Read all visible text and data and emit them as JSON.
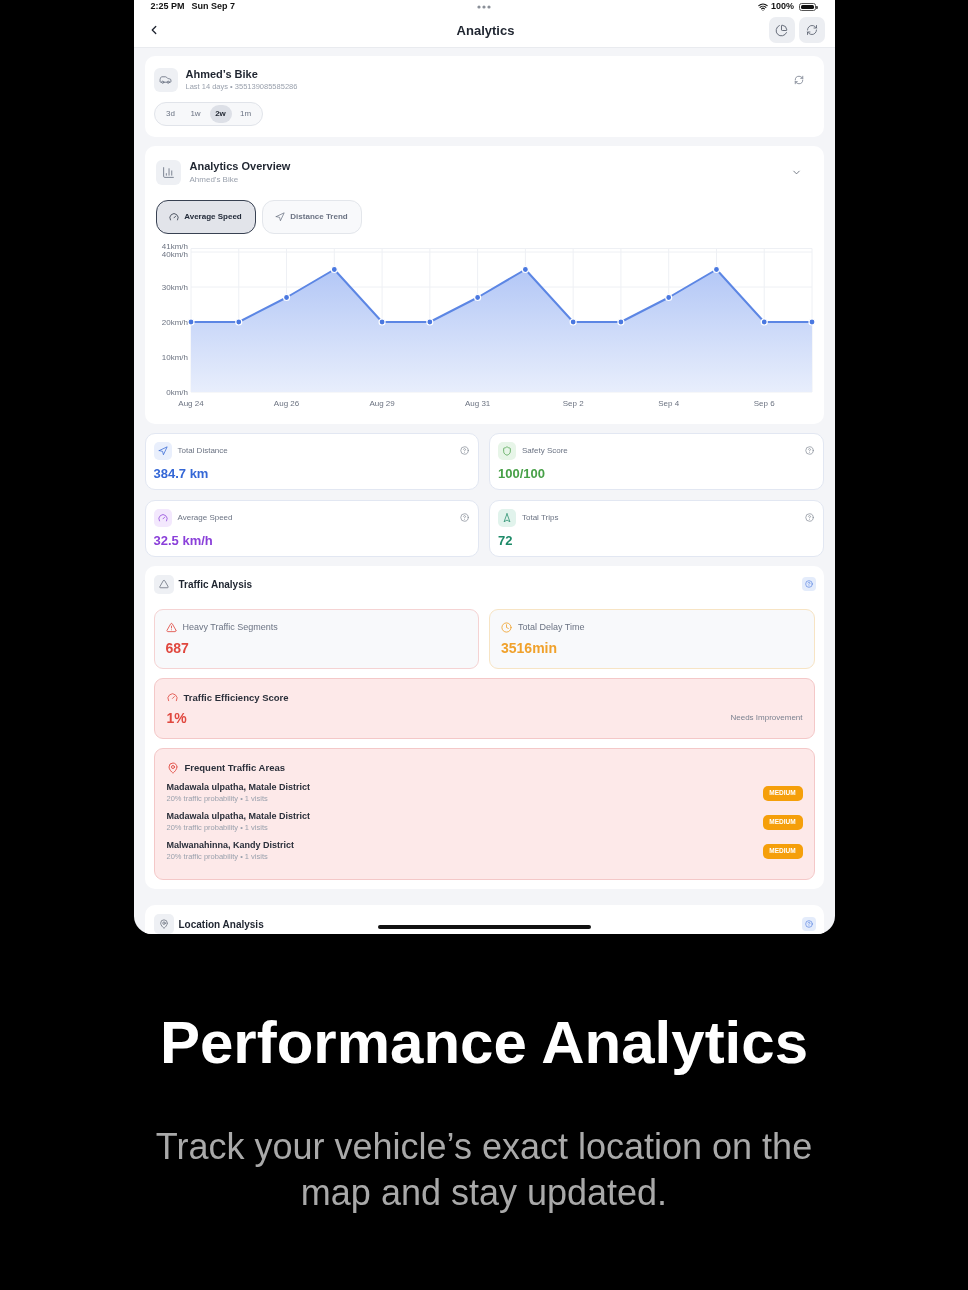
{
  "status_bar": {
    "time": "2:25 PM",
    "date": "Sun Sep 7",
    "battery": "100%"
  },
  "nav": {
    "title": "Analytics"
  },
  "vehicle": {
    "name": "Ahmed’s Bike",
    "subtitle": "Last 14 days • 355139085585286",
    "ranges": [
      {
        "label": "3d",
        "selected": false
      },
      {
        "label": "1w",
        "selected": false
      },
      {
        "label": "2w",
        "selected": true
      },
      {
        "label": "1m",
        "selected": false
      }
    ]
  },
  "overview": {
    "title": "Analytics Overview",
    "subtitle": "Ahmed's Bike",
    "tabs": [
      {
        "kind": "speed",
        "label": "Average Speed",
        "selected": true
      },
      {
        "kind": "distance",
        "label": "Distance Trend",
        "selected": false
      }
    ],
    "chart_data": {
      "type": "area",
      "grid": true,
      "categories": [
        "Aug 24",
        null,
        "Aug 26",
        null,
        "Aug 29",
        null,
        "Aug 31",
        null,
        "Sep 2",
        null,
        "Sep 4",
        null,
        "Sep 6",
        null
      ],
      "values": [
        20,
        20,
        27,
        35,
        20,
        20,
        27,
        35,
        20,
        20,
        27,
        35,
        20,
        20
      ],
      "ylim": [
        0,
        41
      ],
      "yticks": [
        {
          "value": 0,
          "label": "0km/h"
        },
        {
          "value": 10,
          "label": "10km/h"
        },
        {
          "value": 20,
          "label": "20km/h"
        },
        {
          "value": 30,
          "label": "30km/h"
        },
        {
          "value": 40,
          "label": "40km/h"
        },
        {
          "value": 41,
          "label": "41km/h"
        }
      ]
    }
  },
  "stats": [
    {
      "kind": "distance",
      "label": "Total Distance",
      "value": "384.7 km",
      "color": "#3467d6"
    },
    {
      "kind": "safety",
      "label": "Safety Score",
      "value": "100/100",
      "color": "#47a047"
    },
    {
      "kind": "speed",
      "label": "Average Speed",
      "value": "32.5 km/h",
      "color": "#8a3fd9"
    },
    {
      "kind": "trips",
      "label": "Total Trips",
      "value": "72",
      "color": "#1d8a68"
    }
  ],
  "traffic": {
    "title": "Traffic Analysis",
    "metrics": [
      {
        "kind": "heavy",
        "label": "Heavy Traffic Segments",
        "value": "687",
        "color": "#e0483f"
      },
      {
        "kind": "delay",
        "label": "Total Delay Time",
        "value": "3516min",
        "color": "#f0a12b"
      }
    ],
    "efficiency": {
      "title": "Traffic Efficiency Score",
      "value": "1%",
      "status": "Needs Improvement"
    },
    "areas": {
      "title": "Frequent Traffic Areas",
      "items": [
        {
          "name": "Madawala ulpatha, Matale District",
          "detail": "20% traffic probability • 1 visits",
          "badge": "MEDIUM"
        },
        {
          "name": "Madawala ulpatha, Matale District",
          "detail": "20% traffic probability • 1 visits",
          "badge": "MEDIUM"
        },
        {
          "name": "Malwanahinna, Kandy District",
          "detail": "20% traffic probability • 1 visits",
          "badge": "MEDIUM"
        }
      ]
    }
  },
  "location": {
    "title": "Location Analysis"
  },
  "promo": {
    "heading": "Performance Analytics",
    "text": "Track your vehicle’s exact location on the map and stay updated."
  }
}
